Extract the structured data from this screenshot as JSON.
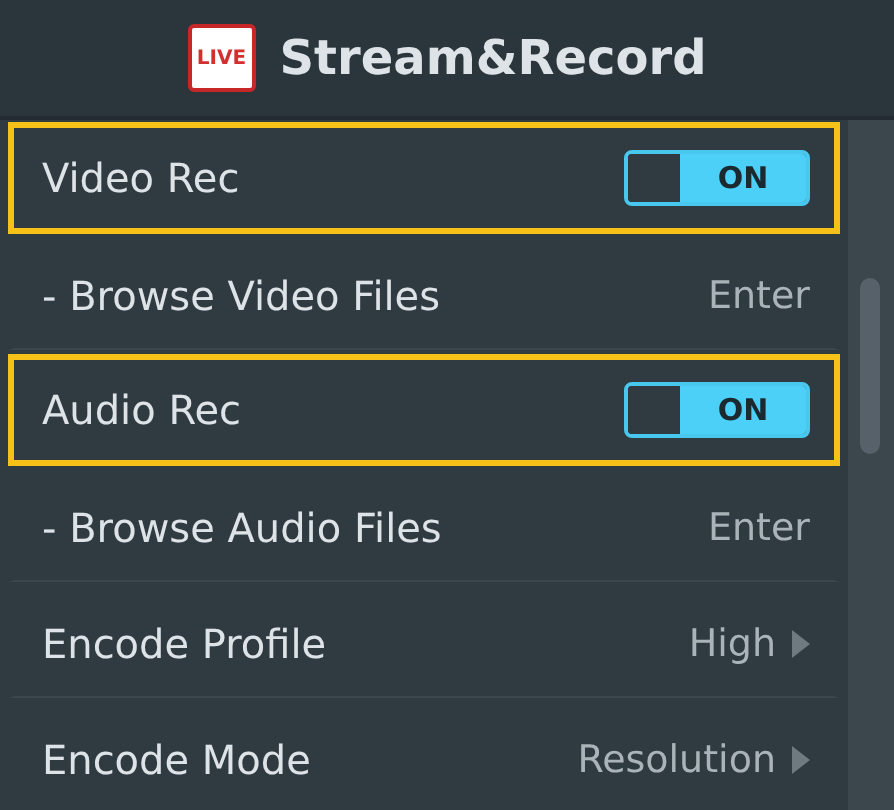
{
  "header": {
    "badge": "LIVE",
    "title": "Stream&Record"
  },
  "rows": [
    {
      "kind": "toggle",
      "label": "Video Rec",
      "highlighted": true,
      "on": true,
      "value": "ON"
    },
    {
      "kind": "action",
      "label": "- Browse Video Files",
      "highlighted": false,
      "value": "Enter"
    },
    {
      "kind": "toggle",
      "label": "Audio Rec",
      "highlighted": true,
      "on": true,
      "value": "ON"
    },
    {
      "kind": "action",
      "label": "- Browse Audio Files",
      "highlighted": false,
      "value": "Enter"
    },
    {
      "kind": "choice",
      "label": "Encode Profile",
      "highlighted": false,
      "value": "High"
    },
    {
      "kind": "choice",
      "label": "Encode Mode",
      "highlighted": false,
      "value": "Resolution"
    }
  ]
}
